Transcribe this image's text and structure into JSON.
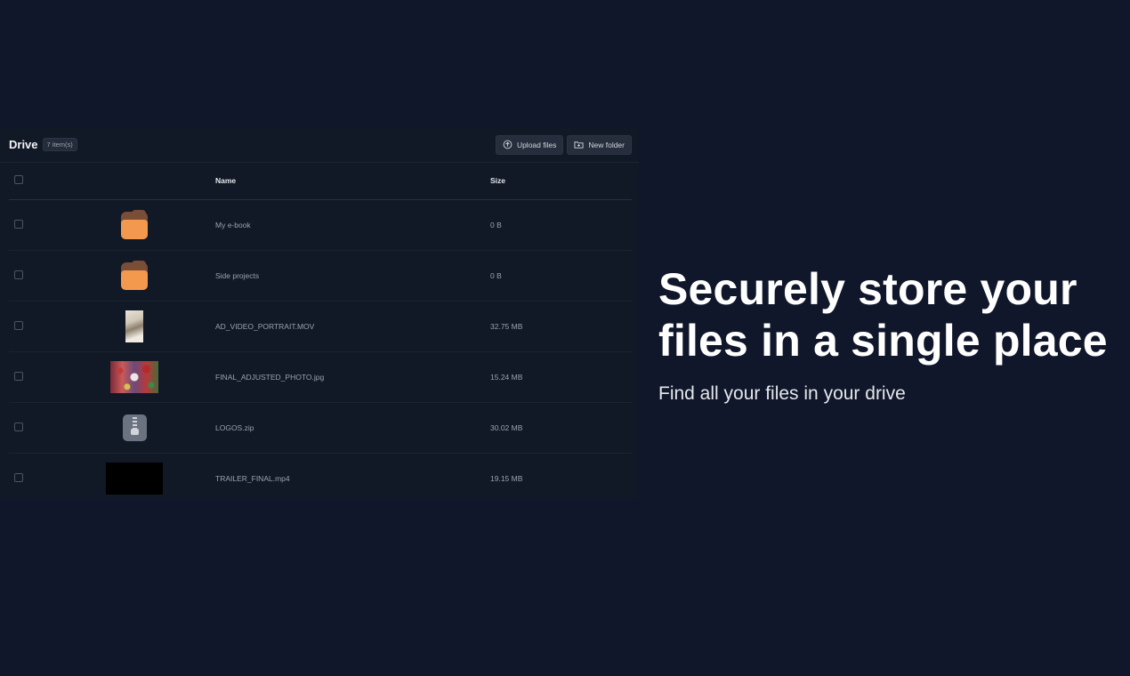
{
  "drive": {
    "title": "Drive",
    "item_count": "7 item(s)",
    "actions": {
      "upload_label": "Upload files",
      "new_folder_label": "New folder"
    },
    "columns": {
      "name": "Name",
      "size": "Size"
    },
    "rows": [
      {
        "thumb": "folder-icon",
        "name": "My e-book",
        "size": "0 B"
      },
      {
        "thumb": "folder-icon",
        "name": "Side projects",
        "size": "0 B"
      },
      {
        "thumb": "video-thumbnail",
        "name": "AD_VIDEO_PORTRAIT.MOV",
        "size": "32.75 MB"
      },
      {
        "thumb": "photo-thumbnail",
        "name": "FINAL_ADJUSTED_PHOTO.jpg",
        "size": "15.24 MB"
      },
      {
        "thumb": "zip-icon",
        "name": "LOGOS.zip",
        "size": "30.02 MB"
      },
      {
        "thumb": "video-thumbnail",
        "name": "TRAILER_FINAL.mp4",
        "size": "19.15 MB"
      }
    ]
  },
  "hero": {
    "title": "Securely store your files in a single place",
    "subtitle": "Find all your files in your drive"
  },
  "colors": {
    "background": "#10172a",
    "panel": "#111826",
    "folder_front": "#f2994d",
    "folder_back": "#7a4d36"
  }
}
